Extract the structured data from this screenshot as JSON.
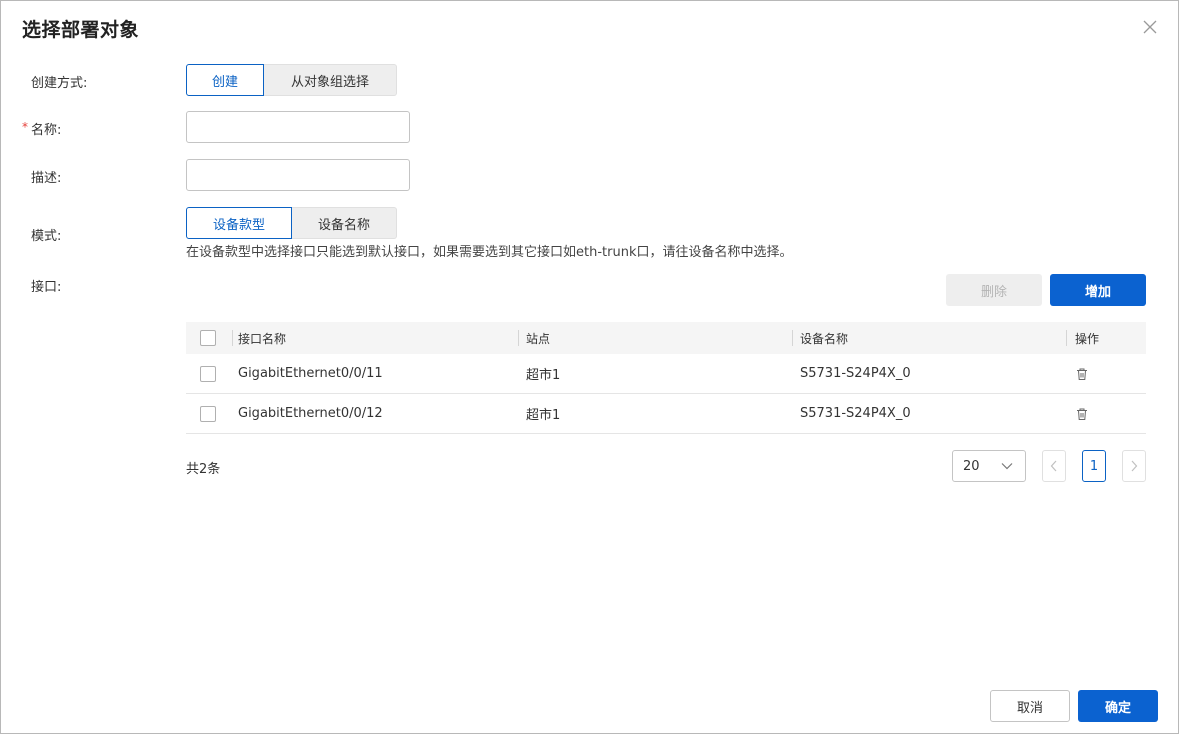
{
  "dialog": {
    "title": "选择部署对象",
    "close_icon": "close-icon"
  },
  "form": {
    "create_method": {
      "label": "创建方式:",
      "options": [
        "创建",
        "从对象组选择"
      ],
      "selected": "创建"
    },
    "name": {
      "label": "名称:",
      "required_mark": "*",
      "value": "",
      "placeholder": ""
    },
    "description": {
      "label": "描述:",
      "value": "",
      "placeholder": ""
    },
    "mode": {
      "label": "模式:",
      "options": [
        "设备款型",
        "设备名称"
      ],
      "selected": "设备款型",
      "hint": "在设备款型中选择接口只能选到默认接口，如果需要选到其它接口如eth-trunk口，请往设备名称中选择。"
    },
    "interface": {
      "label": "接口:"
    }
  },
  "toolbar": {
    "delete_label": "删除",
    "add_label": "增加"
  },
  "table": {
    "columns": [
      "接口名称",
      "站点",
      "设备名称",
      "操作"
    ],
    "rows": [
      {
        "interface": "GigabitEthernet0/0/11",
        "site": "超市1",
        "device": "S5731-S24P4X_0",
        "action_icon": "trash-icon"
      },
      {
        "interface": "GigabitEthernet0/0/12",
        "site": "超市1",
        "device": "S5731-S24P4X_0",
        "action_icon": "trash-icon"
      }
    ]
  },
  "pagination": {
    "total": "共2条",
    "page_size": "20",
    "current_page": "1"
  },
  "footer": {
    "cancel_label": "取消",
    "confirm_label": "确定"
  },
  "colors": {
    "primary": "#0b62d0",
    "required": "#e5413b"
  }
}
